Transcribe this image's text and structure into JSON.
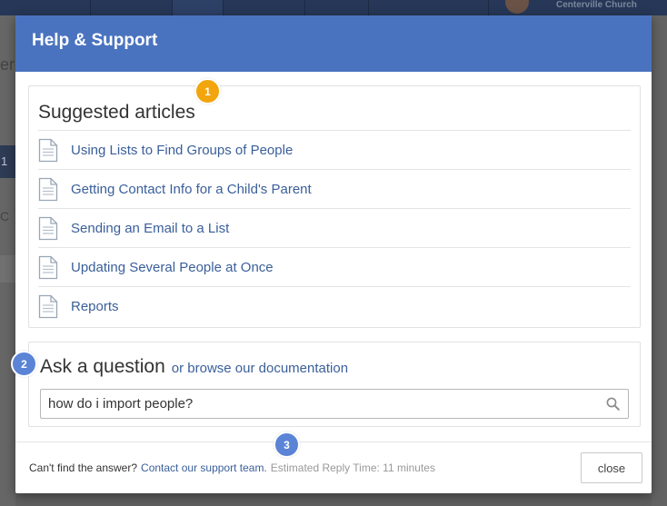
{
  "background": {
    "org_name": "Centerville Church",
    "left_fragment_1": "er",
    "left_fragment_2": "1",
    "left_fragment_3": "C"
  },
  "modal": {
    "title": "Help & Support",
    "suggested": {
      "heading": "Suggested articles",
      "articles": [
        {
          "label": "Using Lists to Find Groups of People",
          "icon": "document-icon"
        },
        {
          "label": "Getting Contact Info for a Child's Parent",
          "icon": "document-icon"
        },
        {
          "label": "Sending an Email to a List",
          "icon": "document-icon"
        },
        {
          "label": "Updating Several People at Once",
          "icon": "document-icon"
        },
        {
          "label": "Reports",
          "icon": "document-icon"
        }
      ]
    },
    "question": {
      "heading": "Ask a question",
      "browse_link": "or browse our documentation",
      "search_value": "how do i import people?",
      "search_icon": "search-icon"
    },
    "footer": {
      "prompt": "Can't find the answer?",
      "contact_link": "Contact our support team.",
      "reply_time": "Estimated Reply Time: 11 minutes",
      "close_label": "close"
    }
  },
  "callouts": [
    "1",
    "2",
    "3"
  ],
  "colors": {
    "header": "#4a73bf",
    "link": "#3a5f9a",
    "callout_orange": "#f2a50c",
    "callout_blue": "#5b84d6"
  }
}
